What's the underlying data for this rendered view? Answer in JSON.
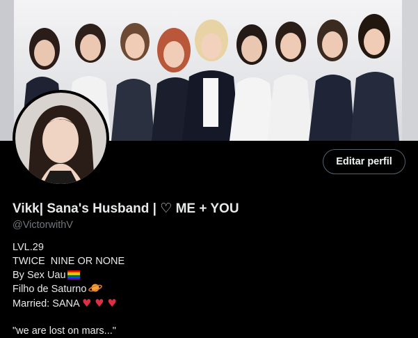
{
  "profile": {
    "display_name": "Vikk| Sana's Husband | ♡ ME + YOU",
    "handle": "@VictorwithV",
    "edit_button_label": "Editar perfil",
    "bio": {
      "line1": "LVL.29",
      "line2": "TWICE  NINE OR NONE",
      "line3": "By Sex Uau",
      "line3_emoji": "rainbow-flag",
      "line4": "Filho de Saturno",
      "line4_emoji": "ringed-planet",
      "line5": "Married: SANA",
      "line5_hearts": "♥ ♥ ♥",
      "line6": "\"we are lost on mars...\""
    }
  },
  "colors": {
    "background": "#000000",
    "text_primary": "#e7e9ea",
    "text_secondary": "#71767b",
    "button_border": "#536471",
    "heart": "#dd2e44"
  }
}
